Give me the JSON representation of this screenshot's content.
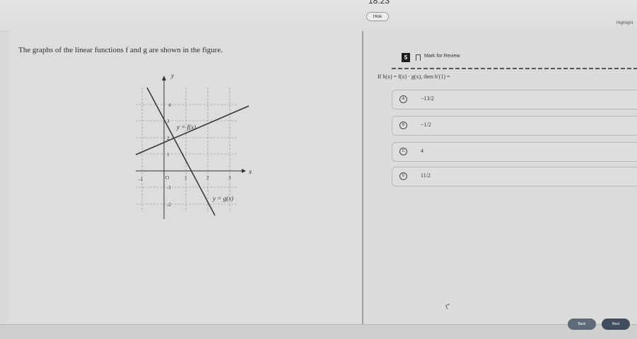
{
  "top": {
    "timer": "18:23",
    "hide_label": "Hide",
    "highlight_label": "Highlight"
  },
  "tools": {
    "left_icon": "calculator-icon",
    "right_icon": "reference-icon"
  },
  "prompt": "The graphs of the linear functions f and g are shown in the figure.",
  "graph": {
    "y_axis_label": "y",
    "x_axis_label": "x",
    "x_ticks": [
      "-1",
      "O",
      "1",
      "2",
      "3"
    ],
    "y_ticks": [
      "4",
      "3",
      "2",
      "1",
      "-1",
      "-2"
    ],
    "f_label": "y = f(x)",
    "g_label": "y = g(x)"
  },
  "question": {
    "number": "5",
    "mark_label": "Mark for Review",
    "text": "If h(x) = f(x) · g(x), then h′(1) ="
  },
  "choices": [
    {
      "letter": "A",
      "value": "−13/2"
    },
    {
      "letter": "B",
      "value": "−1/2"
    },
    {
      "letter": "C",
      "value": "4"
    },
    {
      "letter": "D",
      "value": "11/2"
    }
  ],
  "nav": {
    "back": "Back",
    "next": "Next"
  }
}
